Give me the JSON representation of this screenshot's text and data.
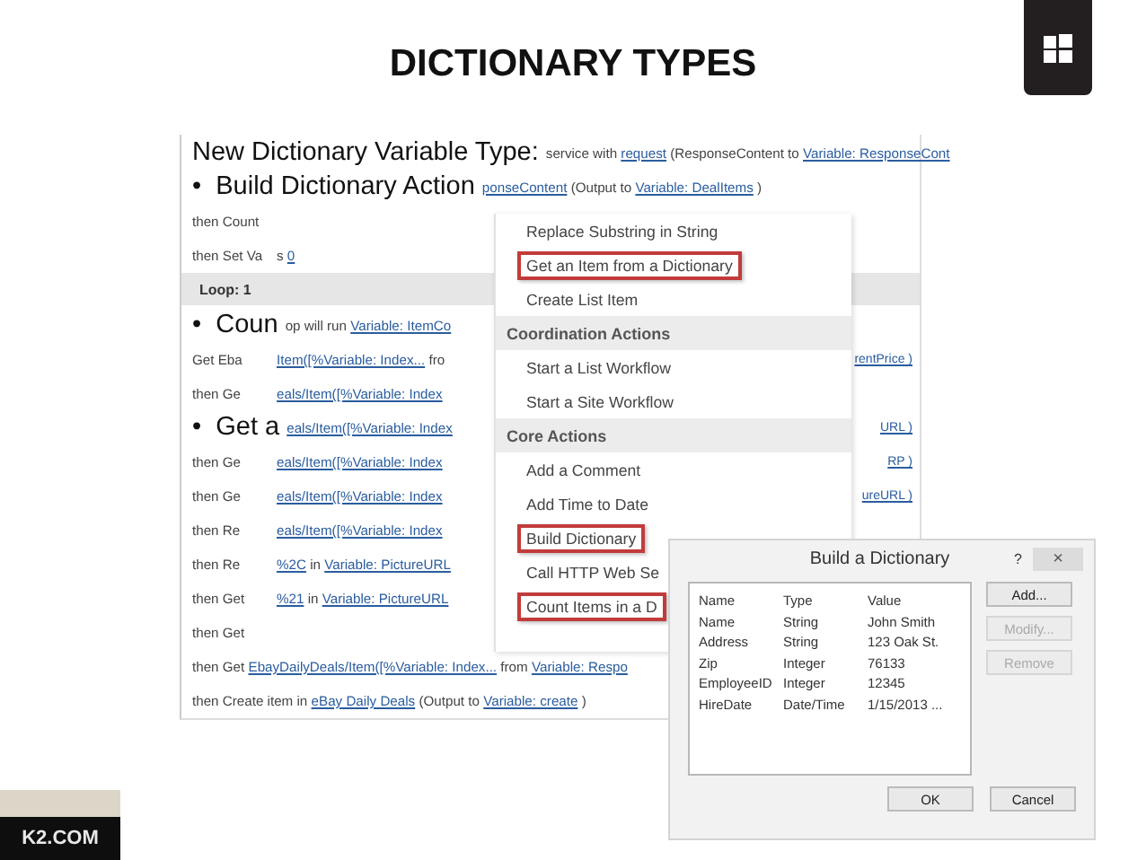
{
  "slide": {
    "title": "DICTIONARY TYPES",
    "footer": "K2.COM"
  },
  "workflow": {
    "rows": [
      {
        "kind": "code",
        "lead": "New Dictionary Variable Type:",
        "parts": [
          {
            "text": "service with ",
            "link": false
          },
          {
            "text": "request",
            "link": true
          },
          {
            "text": " (ResponseContent to ",
            "link": false
          },
          {
            "text": "Variable: ResponseCont",
            "link": true
          }
        ]
      },
      {
        "kind": "code",
        "marker": "•",
        "lead": "Build Dictionary Action",
        "parts": [
          {
            "text": "ponseContent",
            "link": true
          },
          {
            "text": " (Output to ",
            "link": false
          },
          {
            "text": "Variable: DealItems",
            "link": true
          },
          {
            "text": " )",
            "link": false
          }
        ]
      },
      {
        "kind": "code",
        "left": "then Count"
      },
      {
        "kind": "code",
        "left": "then Set Va",
        "parts": [
          {
            "text": "s ",
            "link": false
          },
          {
            "text": "0",
            "link": true
          }
        ]
      },
      {
        "kind": "loop",
        "label": "Loop: 1"
      },
      {
        "kind": "code",
        "marker": "•",
        "lead": "Coun",
        "parts": [
          {
            "text": "op will run ",
            "link": false
          },
          {
            "text": "Variable: ItemCo",
            "link": true
          }
        ]
      },
      {
        "kind": "code",
        "left": "Get Eba",
        "parts": [
          {
            "text": "Item([%Variable: Index...",
            "link": true
          },
          {
            "text": " fro",
            "link": false
          }
        ],
        "right": "rentPrice )"
      },
      {
        "kind": "code",
        "left": "then Ge",
        "parts": [
          {
            "text": "eals/Item([%Variable: Index",
            "link": true
          }
        ]
      },
      {
        "kind": "code",
        "marker": "•",
        "lead": "Get a",
        "parts": [
          {
            "text": "eals/Item([%Variable: Index",
            "link": true
          }
        ],
        "right": "URL )"
      },
      {
        "kind": "code",
        "left": "then Ge",
        "parts": [
          {
            "text": "eals/Item([%Variable: Index",
            "link": true
          }
        ],
        "right": "RP )"
      },
      {
        "kind": "code",
        "left": "then Ge",
        "parts": [
          {
            "text": "eals/Item([%Variable: Index",
            "link": true
          }
        ],
        "right": "ureURL )"
      },
      {
        "kind": "code",
        "left": "then Re",
        "parts": [
          {
            "text": "eals/Item([%Variable: Index",
            "link": true
          }
        ]
      },
      {
        "kind": "code",
        "left": "then Re",
        "parts": [
          {
            "text": "%2C",
            "link": true
          },
          {
            "text": " in ",
            "link": false
          },
          {
            "text": "Variable: PictureURL",
            "link": true
          }
        ]
      },
      {
        "kind": "code",
        "left": "then Get",
        "parts": [
          {
            "text": "%21",
            "link": true
          },
          {
            "text": " in ",
            "link": false
          },
          {
            "text": "Variable: PictureURL",
            "link": true
          }
        ]
      },
      {
        "kind": "code",
        "left": "then Get"
      },
      {
        "kind": "line",
        "left": "then Get ",
        "parts": [
          {
            "text": "EbayDailyDeals/Item([%Variable: Index...",
            "link": true
          },
          {
            "text": " from ",
            "link": false
          },
          {
            "text": "Variable: Respo",
            "link": true
          }
        ]
      },
      {
        "kind": "line",
        "left": "then Create item in ",
        "parts": [
          {
            "text": "eBay Daily Deals",
            "link": true
          },
          {
            "text": " (Output to ",
            "link": false
          },
          {
            "text": "Variable: create",
            "link": true
          },
          {
            "text": " )",
            "link": false
          }
        ]
      }
    ]
  },
  "menu": {
    "items": [
      {
        "kind": "item",
        "label": "Replace Substring in String",
        "highlighted": false
      },
      {
        "kind": "item",
        "label": "Get an Item from a Dictionary",
        "highlighted": true
      },
      {
        "kind": "item",
        "label": "Create List Item",
        "highlighted": false
      },
      {
        "kind": "header",
        "label": "Coordination Actions"
      },
      {
        "kind": "item",
        "label": "Start a List Workflow",
        "highlighted": false
      },
      {
        "kind": "item",
        "label": "Start a Site Workflow",
        "highlighted": false
      },
      {
        "kind": "header",
        "label": "Core Actions"
      },
      {
        "kind": "item",
        "label": "Add a Comment",
        "highlighted": false
      },
      {
        "kind": "item",
        "label": "Add Time to Date",
        "highlighted": false
      },
      {
        "kind": "item",
        "label": "Build Dictionary",
        "highlighted": true
      },
      {
        "kind": "item",
        "label": "Call HTTP Web Se",
        "highlighted": false
      },
      {
        "kind": "item",
        "label": "Count Items in a D",
        "highlighted": true
      }
    ]
  },
  "dialog": {
    "title": "Build a Dictionary",
    "help": "?",
    "close": "×",
    "columns": [
      "Name",
      "Type",
      "Value"
    ],
    "rows": [
      [
        "Name",
        "String",
        "John Smith"
      ],
      [
        "Address",
        "String",
        "123 Oak St."
      ],
      [
        "Zip",
        "Integer",
        "76133"
      ],
      [
        "EmployeeID",
        "Integer",
        "12345"
      ],
      [
        "HireDate",
        "Date/Time",
        "1/15/2013 ..."
      ]
    ],
    "buttons": [
      {
        "label": "Add...",
        "disabled": false
      },
      {
        "label": "Modify...",
        "disabled": true
      },
      {
        "label": "Remove",
        "disabled": true
      }
    ],
    "footer_buttons": [
      "OK",
      "Cancel"
    ]
  }
}
